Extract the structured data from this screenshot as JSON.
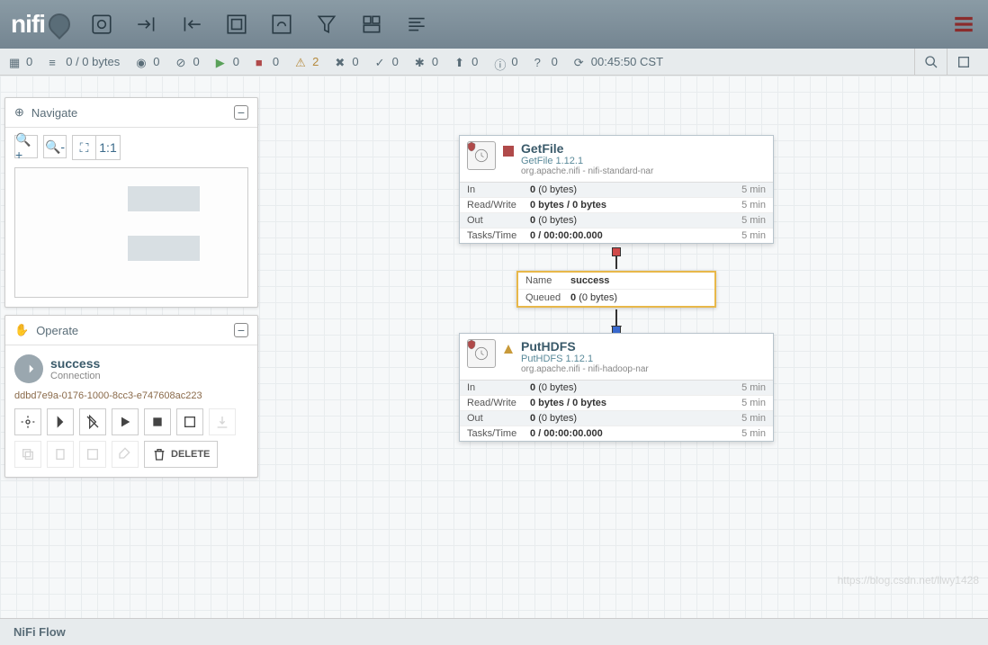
{
  "logo": "nifi",
  "statusBar": {
    "active": "0",
    "queued": "0 / 0 bytes",
    "transmitting": "0",
    "notTransmitting": "0",
    "running": "0",
    "stopped": "0",
    "invalid": "2",
    "disabled": "0",
    "upToDate": "0",
    "locallyModified": "0",
    "stale": "0",
    "sync": "0",
    "unknown": "0",
    "refresh": "00:45:50 CST"
  },
  "navigate": {
    "title": "Navigate"
  },
  "operate": {
    "title": "Operate",
    "name": "success",
    "type": "Connection",
    "uuid": "ddbd7e9a-0176-1000-8cc3-e747608ac223",
    "deleteLabel": "DELETE"
  },
  "proc1": {
    "name": "GetFile",
    "type": "GetFile 1.12.1",
    "bundle": "org.apache.nifi - nifi-standard-nar",
    "stats": {
      "inLabel": "In",
      "inVal": "0",
      "inBytes": "(0 bytes)",
      "inTime": "5 min",
      "rwLabel": "Read/Write",
      "rwVal": "0 bytes / 0 bytes",
      "rwTime": "5 min",
      "outLabel": "Out",
      "outVal": "0",
      "outBytes": "(0 bytes)",
      "outTime": "5 min",
      "ttLabel": "Tasks/Time",
      "ttVal": "0 / 00:00:00.000",
      "ttTime": "5 min"
    }
  },
  "proc2": {
    "name": "PutHDFS",
    "type": "PutHDFS 1.12.1",
    "bundle": "org.apache.nifi - nifi-hadoop-nar",
    "stats": {
      "inLabel": "In",
      "inVal": "0",
      "inBytes": "(0 bytes)",
      "inTime": "5 min",
      "rwLabel": "Read/Write",
      "rwVal": "0 bytes / 0 bytes",
      "rwTime": "5 min",
      "outLabel": "Out",
      "outVal": "0",
      "outBytes": "(0 bytes)",
      "outTime": "5 min",
      "ttLabel": "Tasks/Time",
      "ttVal": "0 / 00:00:00.000",
      "ttTime": "5 min"
    }
  },
  "connection": {
    "nameLabel": "Name",
    "nameVal": "success",
    "queuedLabel": "Queued",
    "queuedVal": "0",
    "queuedBytes": "(0 bytes)"
  },
  "footer": {
    "breadcrumb": "NiFi Flow"
  },
  "watermark": "https://blog.csdn.net/llwy1428"
}
